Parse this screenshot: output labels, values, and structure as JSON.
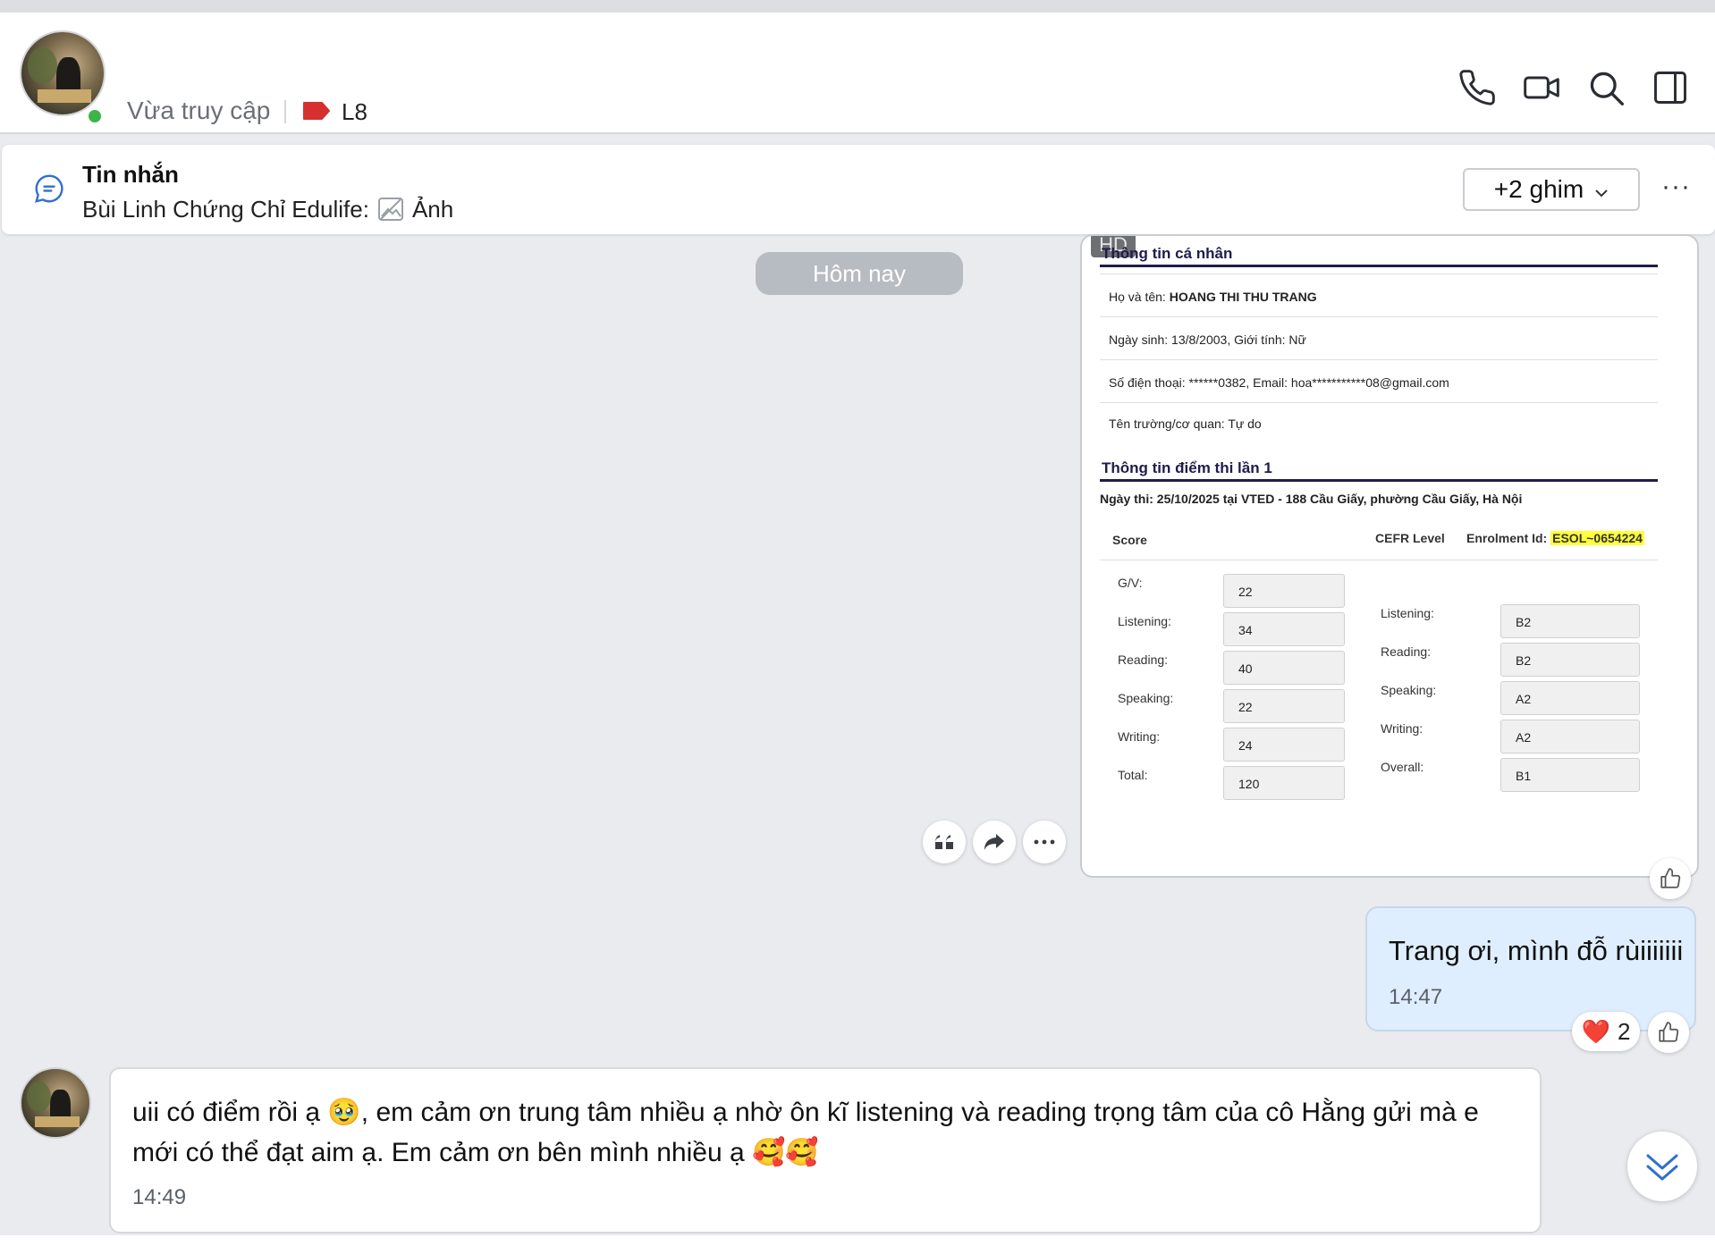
{
  "header": {
    "status": "Vừa truy cập",
    "tag_label": "L8",
    "tag_color": "#d62f2f",
    "icons": [
      "phone-icon",
      "video-call-icon",
      "search-icon",
      "sidebar-toggle-icon"
    ]
  },
  "pinned": {
    "title": "Tin nhắn",
    "sender": "Bùi Linh Chứng Chỉ Edulife:",
    "attachment": "Ảnh",
    "pin_button": "+2 ghim",
    "more": "···"
  },
  "date_divider": "Hôm nay",
  "image_message": {
    "hd_badge": "HD",
    "section1_title": "Thông tin cá nhân",
    "name_label": "Họ và tên:",
    "name_value": "HOANG THI THU TRANG",
    "dob": "Ngày sinh: 13/8/2003, Giới tính: Nữ",
    "contact": "Số điện thoại: ******0382, Email: hoa***********08@gmail.com",
    "school": "Tên trường/cơ quan: Tự do",
    "section2_title": "Thông tin điểm thi lần 1",
    "exam_info": "Ngày thi: 25/10/2025 tại VTED - 188 Cầu Giấy, phường Cầu Giấy, Hà Nội",
    "score_header": "Score",
    "cefr_header": "CEFR Level",
    "enrolment_label": "Enrolment Id:",
    "enrolment_id": "ESOL~0654224",
    "scores": [
      {
        "label": "G/V:",
        "value": "22"
      },
      {
        "label": "Listening:",
        "value": "34"
      },
      {
        "label": "Reading:",
        "value": "40"
      },
      {
        "label": "Speaking:",
        "value": "22"
      },
      {
        "label": "Writing:",
        "value": "24"
      },
      {
        "label": "Total:",
        "value": "120"
      }
    ],
    "cefr": [
      {
        "label": "Listening:",
        "value": "B2"
      },
      {
        "label": "Reading:",
        "value": "B2"
      },
      {
        "label": "Speaking:",
        "value": "A2"
      },
      {
        "label": "Writing:",
        "value": "A2"
      },
      {
        "label": "Overall:",
        "value": "B1"
      }
    ]
  },
  "my_message": {
    "text": "Trang ơi, mình đỗ rùiiiiiii",
    "time": "14:47",
    "reaction_emoji": "❤️",
    "reaction_count": "2"
  },
  "their_message": {
    "text": "uii có điểm rồi ạ 🥹, em cảm ơn trung tâm nhiều ạ nhờ ôn kĩ listening và reading trọng tâm của cô Hằng gửi mà e mới có thể đạt aim ạ. Em cảm ơn bên mình nhiều ạ 🥰🥰",
    "time": "14:49"
  }
}
